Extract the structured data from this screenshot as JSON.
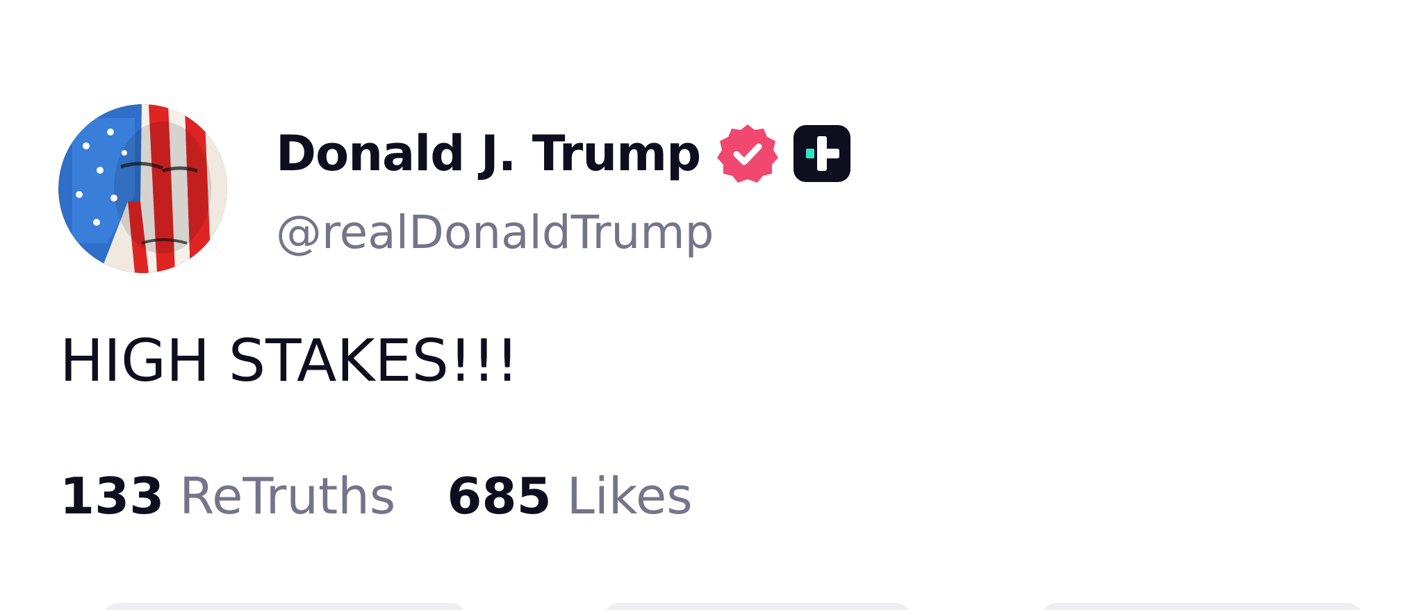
{
  "post": {
    "author": {
      "display_name": "Donald J. Trump",
      "handle": "@realDonaldTrump",
      "avatar": "flag-painted-portrait",
      "verified_icon": "verified-badge-icon",
      "plus_icon": "plus-badge-icon"
    },
    "content": "HIGH STAKES!!!",
    "stats": {
      "retruths_count": "133",
      "retruths_label": "ReTruths",
      "likes_count": "685",
      "likes_label": "Likes"
    }
  },
  "colors": {
    "text_primary": "#0e0e1e",
    "text_secondary": "#74748a",
    "verified_badge": "#f0486e",
    "plus_badge": "#0e0e1e",
    "plus_badge_accent": "#2ee6c4"
  }
}
